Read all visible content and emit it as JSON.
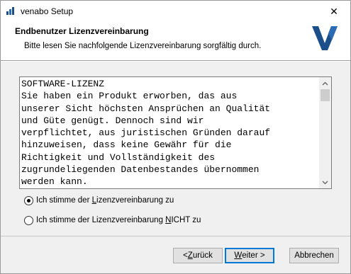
{
  "window": {
    "title": "venabo Setup",
    "close_glyph": "✕"
  },
  "header": {
    "title": "Endbenutzer Lizenzvereinbarung",
    "subtitle": "Bitte lesen Sie nachfolgende Lizenzvereinbarung sorgfältig durch.",
    "logo_color": "#1b4f8a"
  },
  "license": {
    "text": "SOFTWARE-LIZENZ\nSie haben ein Produkt erworben, das aus\nunserer Sicht höchsten Ansprüchen an Qualität\nund Güte genügt. Dennoch sind wir\nverpflichtet, aus juristischen Gründen darauf\nhinzuweisen, dass keine Gewähr für die\nRichtigkeit und Vollständigkeit des\nzugrundeliegenden Datenbestandes übernommen\nwerden kann."
  },
  "options": {
    "accept": {
      "pre": "Ich stimme der ",
      "accel": "L",
      "post": "izenzvereinbarung zu",
      "checked": true
    },
    "decline": {
      "pre": "Ich stimme der Lizenzvereinbarung ",
      "accel": "N",
      "post": "ICHT zu",
      "checked": false
    }
  },
  "buttons": {
    "back": {
      "pre": "< ",
      "accel": "Z",
      "post": "urück"
    },
    "next": {
      "pre": "",
      "accel": "W",
      "post": "eiter >"
    },
    "cancel": "Abbrechen"
  }
}
